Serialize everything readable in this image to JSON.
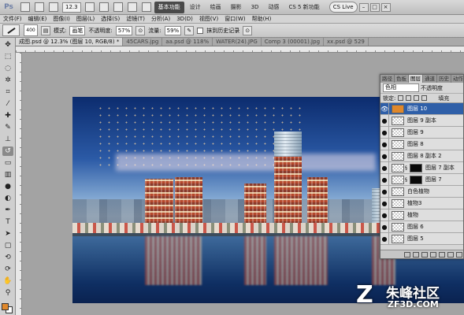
{
  "app": {
    "logo": "Ps",
    "zoom_field": "12.3",
    "workspaces": [
      "基本功能",
      "设计",
      "绘画",
      "摄影",
      "3D",
      "动感",
      "CS 5 新功能"
    ],
    "cs_live": "CS Live",
    "window_controls": [
      "–",
      "□",
      "×"
    ]
  },
  "menu": [
    "文件(F)",
    "编辑(E)",
    "图像(I)",
    "图层(L)",
    "选择(S)",
    "滤镜(T)",
    "分析(A)",
    "3D(D)",
    "视图(V)",
    "窗口(W)",
    "帮助(H)"
  ],
  "options": {
    "brush_size": "400",
    "mode_label": "模式:",
    "mode_value": "画笔",
    "opacity_label": "不透明度:",
    "opacity_value": "57%",
    "flow_label": "流量:",
    "flow_value": "59%",
    "erase_history_label": "抹到历史记录"
  },
  "doc_tabs": [
    "成图.psd @ 12.3% (图层 10, RGB/8) *",
    "45CARS.jpg",
    "aa.psd @ 118%",
    "WATER(24).JPG",
    "Comp 3 (00001).Jpg",
    "xx.psd @ 529"
  ],
  "layers_panel": {
    "tabs": [
      "路径",
      "色板",
      "图层",
      "通道",
      "历史",
      "动作"
    ],
    "blend_mode": "色相",
    "opacity_label": "不透明度",
    "lock_label": "锁定:",
    "fill_label": "填充",
    "layers": [
      {
        "name": "图层 10",
        "thumb": "orange",
        "selected": true,
        "mask": false
      },
      {
        "name": "图层 9 副本",
        "thumb": "checker",
        "selected": false,
        "mask": false
      },
      {
        "name": "图层 9",
        "thumb": "checker",
        "selected": false,
        "mask": false
      },
      {
        "name": "图层 8",
        "thumb": "checker",
        "selected": false,
        "mask": false
      },
      {
        "name": "图层 8 副本 2",
        "thumb": "checker",
        "selected": false,
        "mask": false
      },
      {
        "name": "图层 7 副本",
        "thumb": "checker",
        "selected": false,
        "mask": true
      },
      {
        "name": "图层 7",
        "thumb": "checker",
        "selected": false,
        "mask": true
      },
      {
        "name": "白色植物",
        "thumb": "checker",
        "selected": false,
        "mask": false
      },
      {
        "name": "植物3",
        "thumb": "checker",
        "selected": false,
        "mask": false
      },
      {
        "name": "植物",
        "thumb": "checker",
        "selected": false,
        "mask": false
      },
      {
        "name": "图层 6",
        "thumb": "checker",
        "selected": false,
        "mask": false
      },
      {
        "name": "图层 5",
        "thumb": "checker",
        "selected": false,
        "mask": false
      }
    ]
  },
  "watermark": {
    "cn": "朱峰社区",
    "en": "ZF3D.COM"
  },
  "colors": {
    "foreground": "#e0882b",
    "background": "#ffffff",
    "selection": "#2f5fa8"
  }
}
